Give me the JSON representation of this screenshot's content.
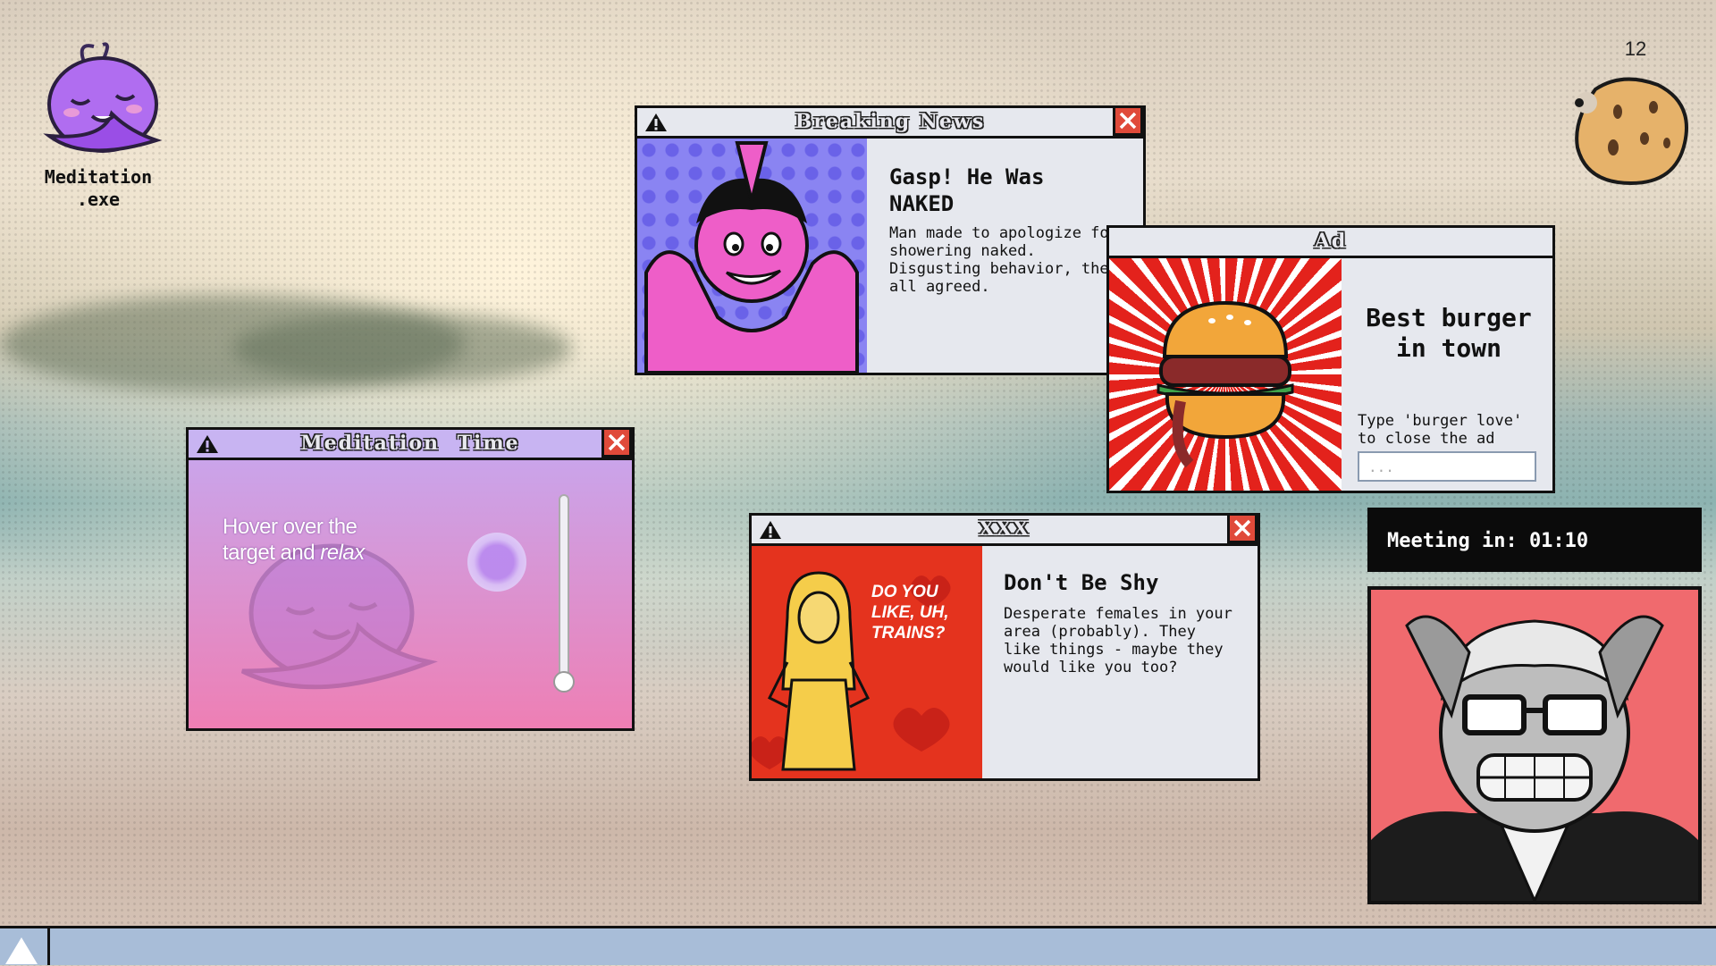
{
  "desktop": {
    "icon_label": "Meditation\n.exe",
    "counter": "12"
  },
  "news_window": {
    "title": "Breaking News",
    "headline": "Gasp! He Was NAKED",
    "body": "Man made to apologize for showering naked. Disgusting behavior, they all agreed."
  },
  "ad_window": {
    "title": "Ad",
    "headline": "Best burger in town",
    "instruction": "Type 'burger love' to close the ad",
    "input_placeholder": "..."
  },
  "meditation_window": {
    "title": "Meditation Time",
    "text_line1": "Hover over the",
    "text_line2": "target and ",
    "text_emph": "relax",
    "slider_level": 0.0
  },
  "xxx_window": {
    "title": "XXX",
    "comic_text": "DO YOU LIKE, UH, TRAINS?",
    "headline": "Don't Be Shy",
    "body": "Desperate females in your area (probably). They like things - maybe they would like you too?"
  },
  "meeting": {
    "label": "Meeting in: 01:10"
  },
  "colors": {
    "titlebar": "#e6e8ee",
    "close": "#e04a3a",
    "meditation_gradient_top": "#c6a8f0",
    "meditation_gradient_bottom": "#ee7fb4",
    "taskbar": "#a8bdd8"
  }
}
